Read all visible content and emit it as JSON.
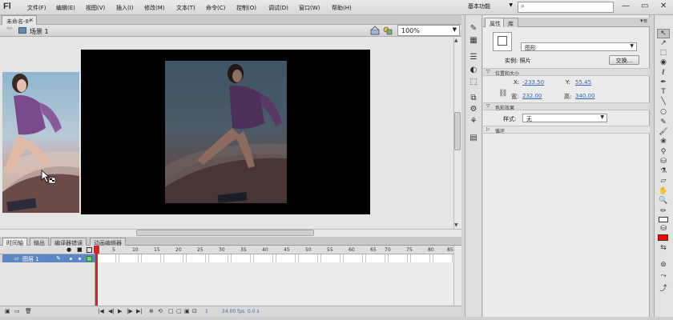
{
  "app": {
    "logo": "Fl",
    "menu": [
      "文件(F)",
      "编辑(E)",
      "视图(V)",
      "插入(I)",
      "修改(M)",
      "文本(T)",
      "命令(C)",
      "控制(O)",
      "调试(D)",
      "窗口(W)",
      "帮助(H)"
    ],
    "workspace": "基本功能",
    "search_placeholder": ""
  },
  "document": {
    "tab_title": "未命名-8*",
    "scene_label": "场景 1",
    "zoom": "100%"
  },
  "timeline": {
    "tabs": [
      "时间轴",
      "输出",
      "编译器错误",
      "动画编辑器"
    ],
    "frame_numbers": [
      "5",
      "10",
      "15",
      "20",
      "25",
      "30",
      "35",
      "40",
      "45",
      "50",
      "55",
      "60",
      "65",
      "70",
      "75",
      "80",
      "85"
    ],
    "layer_name": "图层 1",
    "current_frame": "1",
    "fps": "24.00 fps",
    "elapsed": "0.0 s"
  },
  "properties": {
    "tabs": [
      "属性",
      "库"
    ],
    "type_value": "图形",
    "instance_label": "实例: 照片",
    "swap_button": "交换...",
    "sections": {
      "position": "位置和大小",
      "color": "色彩效果",
      "loop": "循环"
    },
    "x_label": "X:",
    "x_value": "-233.50",
    "y_label": "Y:",
    "y_value": "55.45",
    "w_label": "宽:",
    "w_value": "232.00",
    "h_label": "高:",
    "h_value": "340.00",
    "style_label": "样式:",
    "style_value": "无"
  },
  "colors": {
    "stage": "#000000",
    "selected_layer": "#5b87c7",
    "playhead": "#e02020",
    "fill": "#ff0000",
    "link": "#2f63b8"
  }
}
